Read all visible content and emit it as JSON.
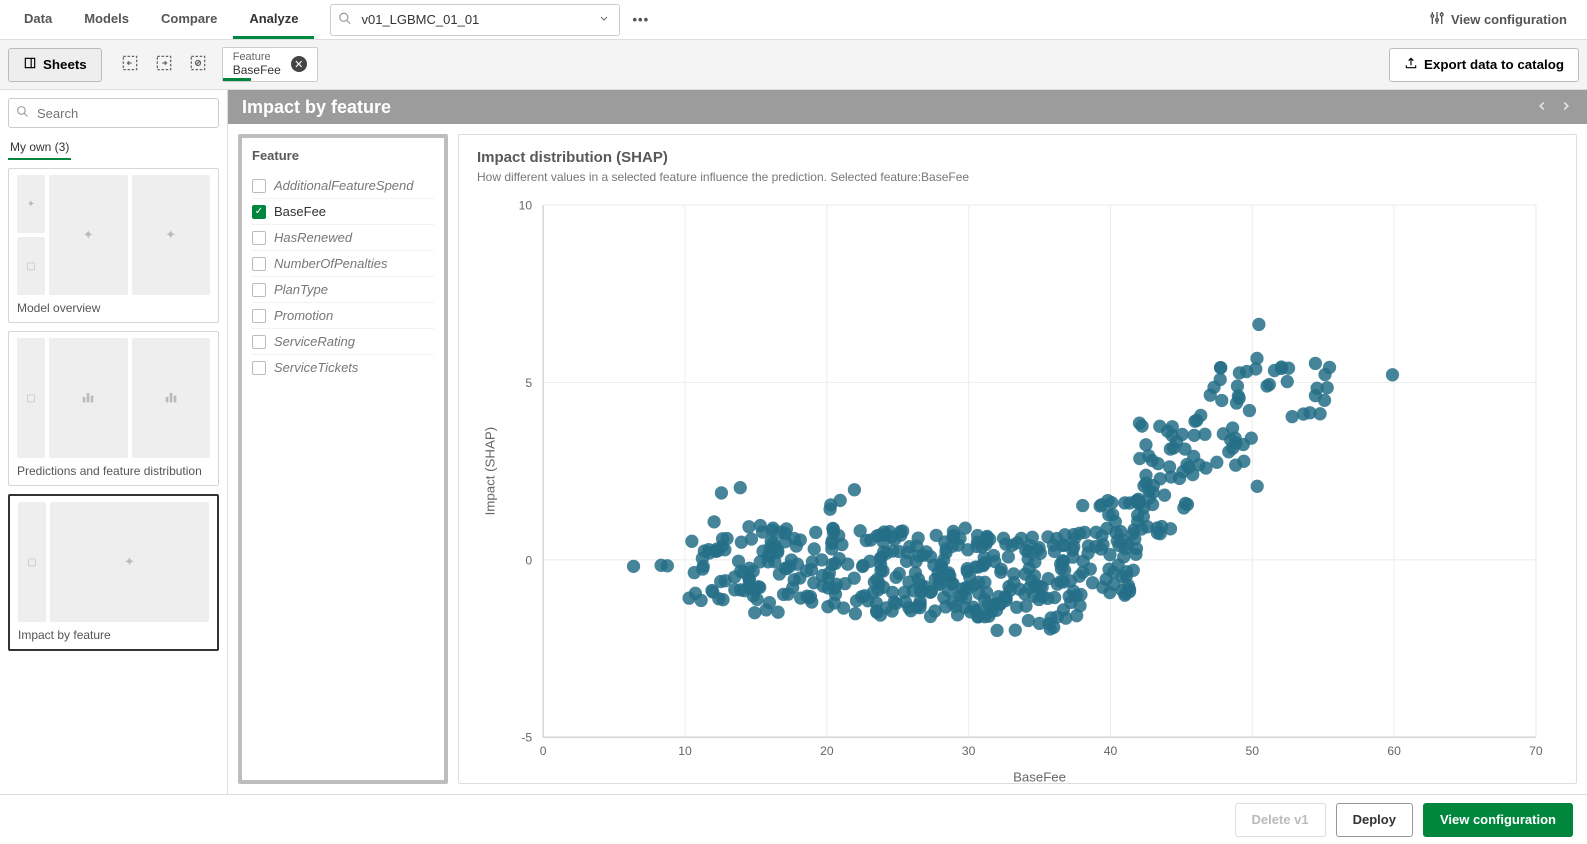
{
  "nav": {
    "tabs": [
      "Data",
      "Models",
      "Compare",
      "Analyze"
    ],
    "active": "Analyze"
  },
  "model_selector": {
    "value": "v01_LGBMC_01_01"
  },
  "top_right": {
    "view_config": "View configuration"
  },
  "toolbar": {
    "sheets": "Sheets",
    "feature_chip": {
      "label": "Feature",
      "value": "BaseFee"
    },
    "export": "Export data to catalog"
  },
  "left_panel": {
    "search_placeholder": "Search",
    "my_own": "My own (3)",
    "sheets": [
      {
        "label": "Model overview"
      },
      {
        "label": "Predictions and feature distribution"
      },
      {
        "label": "Impact by feature"
      }
    ],
    "selected_index": 2
  },
  "banner": {
    "title": "Impact by feature"
  },
  "feature_panel": {
    "header": "Feature",
    "items": [
      {
        "name": "AdditionalFeatureSpend",
        "checked": false
      },
      {
        "name": "BaseFee",
        "checked": true
      },
      {
        "name": "HasRenewed",
        "checked": false
      },
      {
        "name": "NumberOfPenalties",
        "checked": false
      },
      {
        "name": "PlanType",
        "checked": false
      },
      {
        "name": "Promotion",
        "checked": false
      },
      {
        "name": "ServiceRating",
        "checked": false
      },
      {
        "name": "ServiceTickets",
        "checked": false
      }
    ]
  },
  "chart": {
    "title": "Impact distribution (SHAP)",
    "subtitle": "How different values in a selected feature influence the prediction. Selected feature:BaseFee"
  },
  "bottom": {
    "delete": "Delete v1",
    "deploy": "Deploy",
    "view_config": "View configuration"
  },
  "chart_data": {
    "type": "scatter",
    "title": "Impact distribution (SHAP)",
    "xlabel": "BaseFee",
    "ylabel": "Impact (SHAP)",
    "xlim": [
      0,
      70
    ],
    "ylim": [
      -5,
      10
    ],
    "color": "#246e87",
    "clusters": [
      {
        "n": 3,
        "x_range": [
          3,
          9
        ],
        "y_range": [
          -0.4,
          -0.1
        ]
      },
      {
        "n": 30,
        "x_range": [
          10,
          14
        ],
        "y_range": [
          -1.2,
          0.7
        ]
      },
      {
        "n": 3,
        "x_range": [
          12,
          15
        ],
        "y_range": [
          1.0,
          2.8
        ]
      },
      {
        "n": 90,
        "x_range": [
          14,
          22
        ],
        "y_range": [
          -1.5,
          1.0
        ]
      },
      {
        "n": 4,
        "x_range": [
          20,
          24
        ],
        "y_range": [
          1.2,
          2.0
        ]
      },
      {
        "n": 120,
        "x_range": [
          22,
          30
        ],
        "y_range": [
          -1.6,
          0.9
        ]
      },
      {
        "n": 120,
        "x_range": [
          30,
          38
        ],
        "y_range": [
          -1.8,
          0.8
        ]
      },
      {
        "n": 4,
        "x_range": [
          32,
          36
        ],
        "y_range": [
          -2.0,
          -1.9
        ]
      },
      {
        "n": 60,
        "x_range": [
          38,
          42
        ],
        "y_range": [
          -1.0,
          1.8
        ]
      },
      {
        "n": 50,
        "x_range": [
          42,
          46
        ],
        "y_range": [
          0.5,
          4.0
        ]
      },
      {
        "n": 30,
        "x_range": [
          46,
          50
        ],
        "y_range": [
          2.5,
          5.5
        ]
      },
      {
        "n": 20,
        "x_range": [
          50,
          56
        ],
        "y_range": [
          4.0,
          5.7
        ]
      },
      {
        "n": 1,
        "x_range": [
          50.3,
          50.7
        ],
        "y_range": [
          6.5,
          6.7
        ]
      },
      {
        "n": 1,
        "x_range": [
          50.0,
          50.4
        ],
        "y_range": [
          1.9,
          2.1
        ]
      },
      {
        "n": 1,
        "x_range": [
          59.5,
          60.0
        ],
        "y_range": [
          5.2,
          5.4
        ]
      }
    ]
  }
}
